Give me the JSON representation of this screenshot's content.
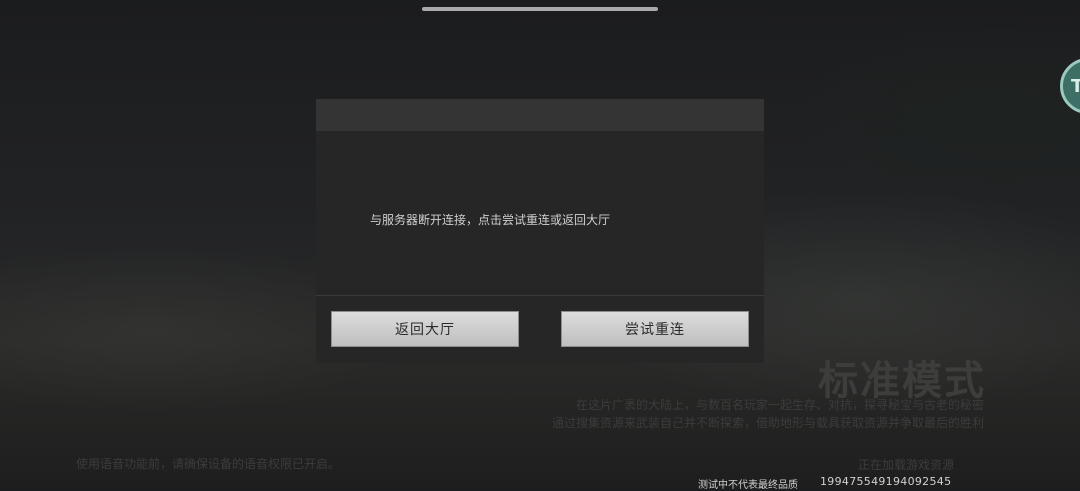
{
  "dialog": {
    "message": "与服务器断开连接，点击尝试重连或返回大厅",
    "buttons": {
      "return_lobby": "返回大厅",
      "retry": "尝试重连"
    }
  },
  "background": {
    "mode_title": "标准模式",
    "mode_desc_line1": "在这片广袤的大陆上，与数百名玩家一起生存、对抗，探寻秘宝与古老的秘密",
    "mode_desc_line2": "通过搜集资源来武装自己并不断探索，借助地形与载具获取资源并争取最后的胜利",
    "voice_tip": "使用语音功能前，请确保设备的语音权限已开启。",
    "loading_tip": "正在加载游戏资源",
    "avatar_letter": "T"
  },
  "footer": {
    "note": "测试中不代表最终品质",
    "id": "19947554919409254​5"
  },
  "colors": {
    "dialog_bg": "#262626",
    "dialog_header": "#343434",
    "button_bg": "#d0d0d0",
    "avatar_accent": "#3e6f66"
  }
}
